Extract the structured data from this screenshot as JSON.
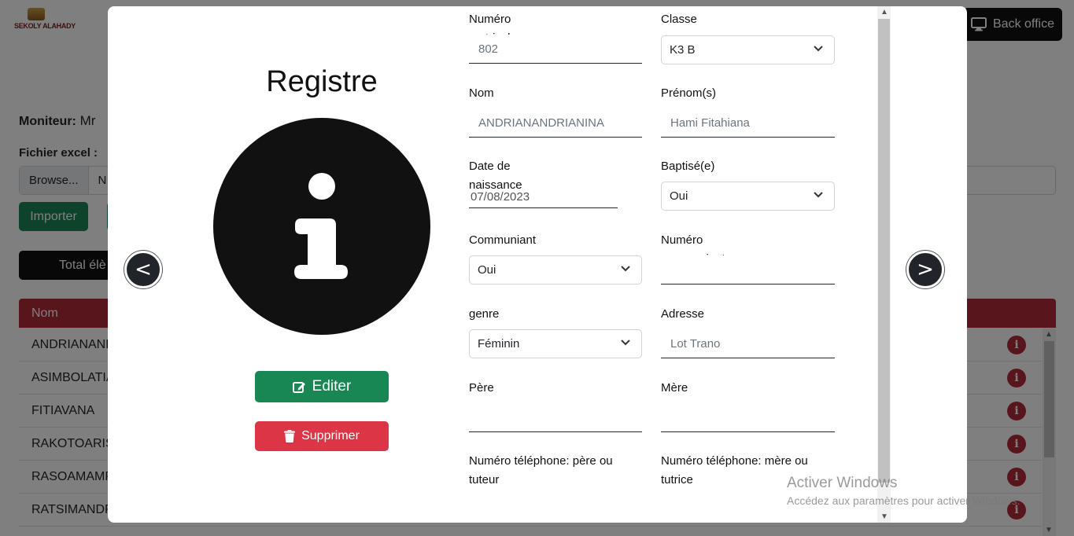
{
  "header": {
    "logo_text": "SEKOLY ALAHADY",
    "back_office_label": "Back office"
  },
  "page": {
    "moniteur_label": "Moniteur:",
    "moniteur_value": "Mr",
    "fichier_label": "Fichier excel :",
    "browse_label": "Browse...",
    "file_name": "N",
    "import_label": "Importer",
    "total_label": "Total élè",
    "table_header": "Nom",
    "rows": [
      "ANDRIANAND",
      "ASIMBOLATIA",
      "FITIAVANA",
      "RAKOTOARIS",
      "RASOAMAMP",
      "RATSIMANDR"
    ],
    "info_glyph": "i"
  },
  "modal": {
    "title": "Registre",
    "prev_glyph": "<",
    "next_glyph": ">",
    "edit_label": "Editer",
    "delete_label": "Supprimer",
    "fields": {
      "matricule_label": "Numéro matricule",
      "matricule_value": "802",
      "classe_label": "Classe",
      "classe_value": "K3 B",
      "nom_label": "Nom",
      "nom_value": "ANDRIANANDRIANINA",
      "prenom_label": "Prénom(s)",
      "prenom_value": "Hami Fitahiana",
      "naissance_label": "Date de naissance",
      "naissance_value": "07/08/2023",
      "baptise_label": "Baptisé(e)",
      "baptise_value": "Oui",
      "communiant_label": "Communiant",
      "communiant_value": "Oui",
      "num_communiant_label": "Numéro communiant",
      "num_communiant_value": "",
      "genre_label": "genre",
      "genre_value": "Féminin",
      "adresse_label": "Adresse",
      "adresse_value": "Lot Trano",
      "pere_label": "Père ou tuteur",
      "pere_value": "",
      "mere_label": "Mère ou tutrice",
      "mere_value": "",
      "tel_pere_label": "Numéro téléphone: père ou tuteur",
      "tel_mere_label": "Numéro téléphone: mère ou tutrice"
    }
  },
  "watermark": {
    "title": "Activer Windows",
    "subtitle": "Accédez aux paramètres pour activer Windows."
  },
  "colors": {
    "success": "#198754",
    "danger": "#dc3545",
    "table_header": "#b02a37",
    "dark": "#212529"
  }
}
